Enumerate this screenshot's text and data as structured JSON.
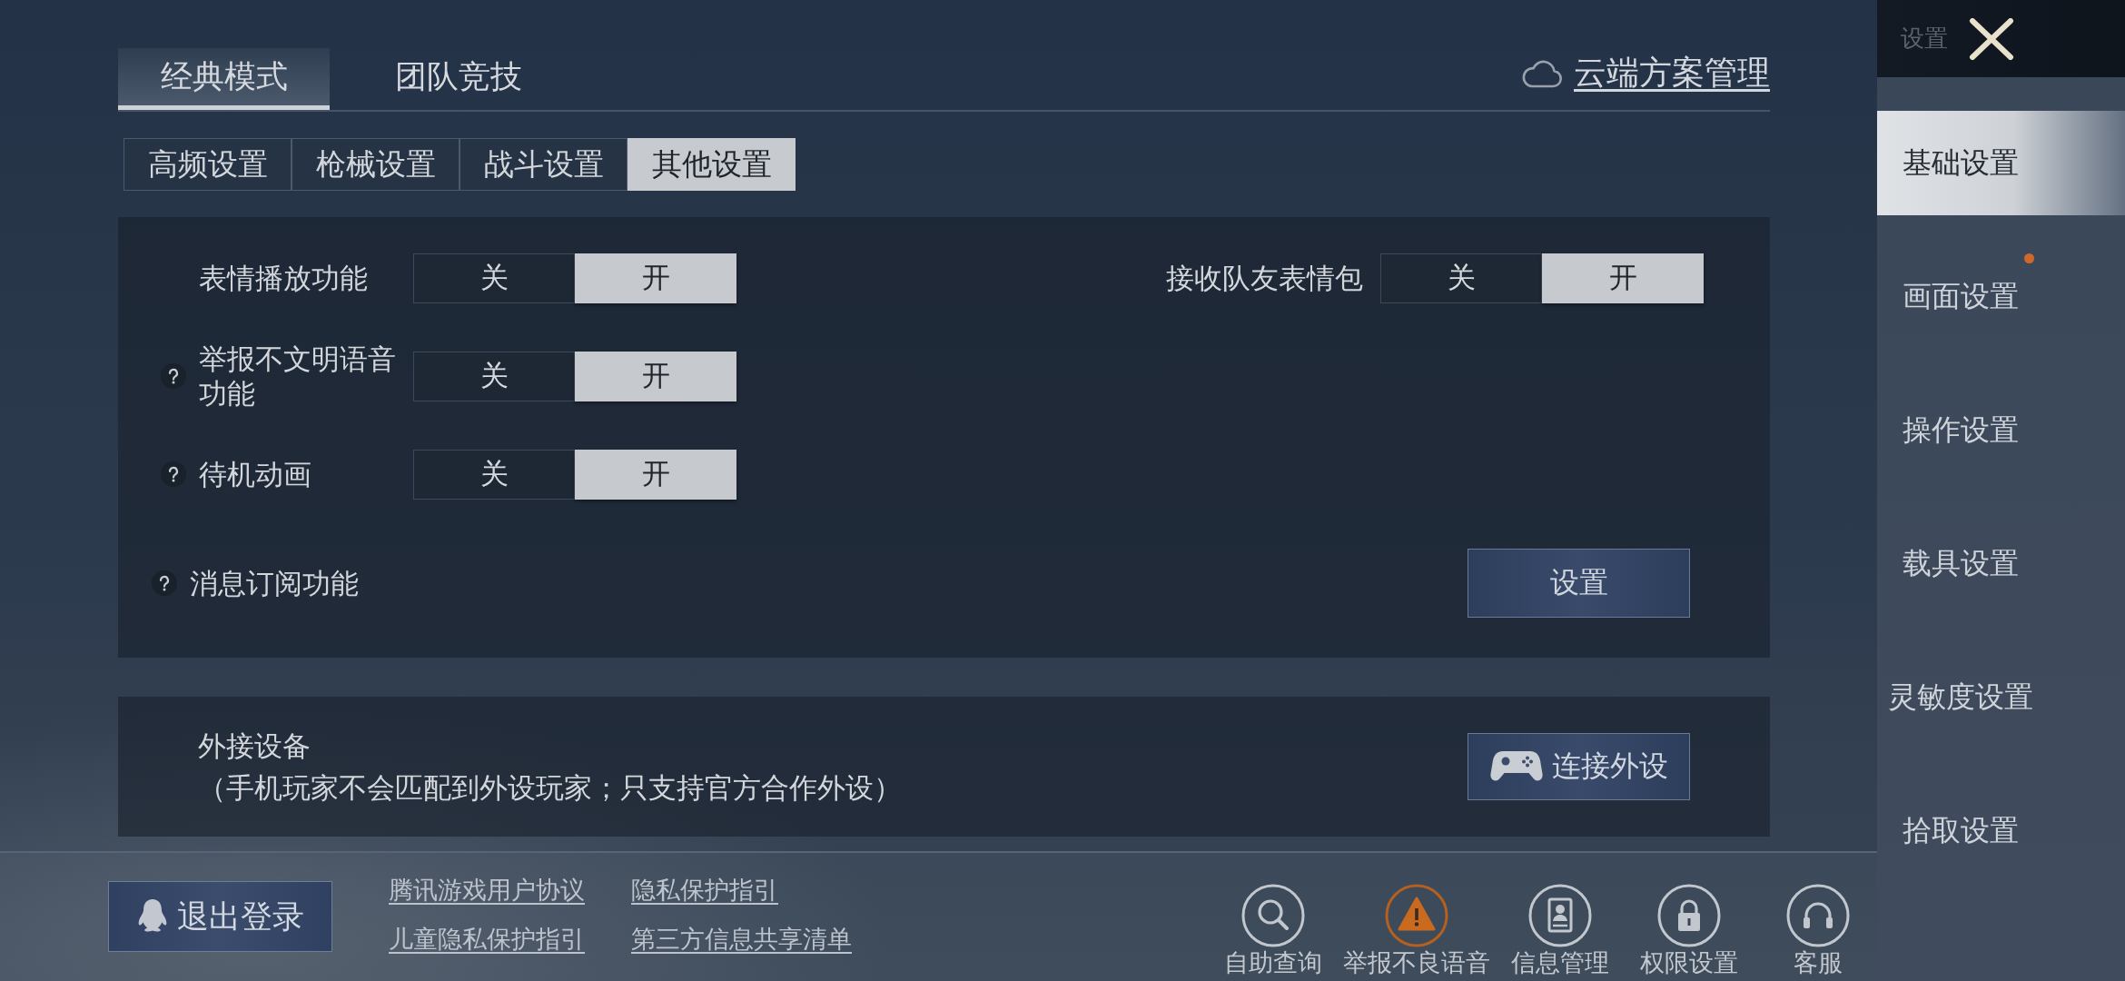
{
  "window": {
    "title": "设置"
  },
  "mode_tabs": [
    {
      "label": "经典模式",
      "selected": true
    },
    {
      "label": "团队竞技",
      "selected": false
    }
  ],
  "cloud_link": "云端方案管理",
  "sub_tabs": [
    {
      "label": "高频设置",
      "selected": false
    },
    {
      "label": "枪械设置",
      "selected": false
    },
    {
      "label": "战斗设置",
      "selected": false
    },
    {
      "label": "其他设置",
      "selected": true
    }
  ],
  "settings_panel": {
    "rows": [
      {
        "items": [
          {
            "kind": "toggle",
            "label": "表情播放功能",
            "help": false,
            "options": [
              {
                "label": "关",
                "selected": false
              },
              {
                "label": "开",
                "selected": true
              }
            ]
          },
          {
            "kind": "toggle",
            "label": "接收队友表情包",
            "help": false,
            "options": [
              {
                "label": "关",
                "selected": false
              },
              {
                "label": "开",
                "selected": true
              }
            ]
          }
        ]
      },
      {
        "items": [
          {
            "kind": "toggle",
            "label": "举报不文明语音功能",
            "help": true,
            "options": [
              {
                "label": "关",
                "selected": false
              },
              {
                "label": "开",
                "selected": true
              }
            ]
          }
        ]
      },
      {
        "items": [
          {
            "kind": "toggle",
            "label": "待机动画",
            "help": true,
            "options": [
              {
                "label": "关",
                "selected": false
              },
              {
                "label": "开",
                "selected": true
              }
            ]
          }
        ]
      },
      {
        "items": [
          {
            "kind": "action",
            "label": "消息订阅功能",
            "help": true,
            "button": "设置"
          }
        ]
      }
    ]
  },
  "peripheral_panel": {
    "title": "外接设备",
    "note": "（手机玩家不会匹配到外设玩家；只支持官方合作外设）",
    "button": "连接外设"
  },
  "footer": {
    "logout_button": "退出登录",
    "links": [
      "腾讯游戏用户协议",
      "隐私保护指引",
      "儿童隐私保护指引",
      "第三方信息共享清单"
    ],
    "actions": [
      {
        "kind": "search",
        "label": "自助查询"
      },
      {
        "kind": "warning",
        "label": "举报不良语音"
      },
      {
        "kind": "profile",
        "label": "信息管理"
      },
      {
        "kind": "lock",
        "label": "权限设置"
      },
      {
        "kind": "headset",
        "label": "客服"
      }
    ]
  },
  "sidebar": {
    "items": [
      {
        "label": "基础设置",
        "selected": true,
        "new": false
      },
      {
        "label": "画面设置",
        "selected": false,
        "new": true
      },
      {
        "label": "操作设置",
        "selected": false,
        "new": false
      },
      {
        "label": "载具设置",
        "selected": false,
        "new": false
      },
      {
        "label": "灵敏度设置",
        "selected": false,
        "new": false
      },
      {
        "label": "拾取设置",
        "selected": false,
        "new": false
      }
    ]
  }
}
